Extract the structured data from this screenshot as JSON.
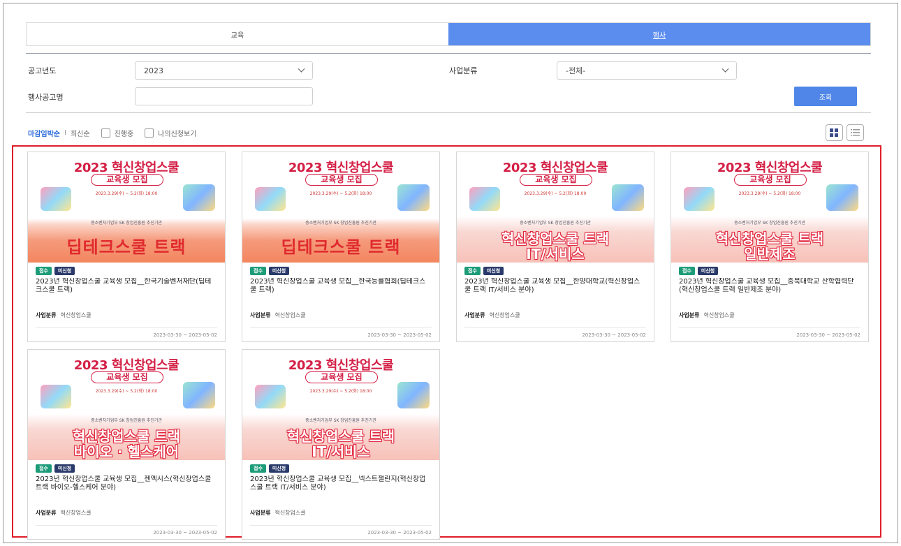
{
  "tabs": [
    {
      "label": "교육",
      "active": false
    },
    {
      "label": "행사",
      "active": true
    }
  ],
  "filters": {
    "year_label": "공고년도",
    "year_value": "2023",
    "category_label": "사업분류",
    "category_value": "-전체-",
    "name_label": "행사공고명",
    "name_value": "",
    "search_button": "조회"
  },
  "sort": {
    "deadline": "마감임박순",
    "separator": "I",
    "latest": "최신순",
    "in_progress": "진행중",
    "my_applications": "나의신청보기"
  },
  "poster": {
    "headline": "2023 혁신창업스쿨",
    "subline": "교육생 모집",
    "dates": "2023.3.29(수) ~ 5.2(화) 18:00",
    "logos": "중소벤처기업부  SK 창업진흥원  추진기관"
  },
  "colors": {
    "accent": "#5b8def",
    "search_button": "#4f86e8",
    "highlight_border": "#e01e2a",
    "status_badge": "#1e9c7a",
    "flag_badge": "#2a3a6a"
  },
  "cards": [
    {
      "track": [
        "딥테크스쿨 트랙"
      ],
      "style": "orange",
      "status": "접수",
      "flag": "미신청",
      "title": "2023년 혁신창업스쿨 교육생 모집__한국기술벤처재단(딥테크스쿨 트랙)",
      "category_label": "사업분류",
      "category": "혁신창업스쿨",
      "period": "2023-03-30 ~ 2023-05-02"
    },
    {
      "track": [
        "딥테크스쿨 트랙"
      ],
      "style": "orange",
      "status": "접수",
      "flag": "미신청",
      "title": "2023년 혁신창업스쿨 교육생 모집__한국능률협회(딥테크스쿨 트랙)",
      "category_label": "사업분류",
      "category": "혁신창업스쿨",
      "period": "2023-03-30 ~ 2023-05-02"
    },
    {
      "track": [
        "혁신창업스쿨 트랙",
        "IT/서비스"
      ],
      "style": "pink",
      "status": "접수",
      "flag": "미신청",
      "title": "2023년 혁신창업스쿨 교육생 모집__한양대학교(혁신창업스쿨 트랙 IT/서비스 분야)",
      "category_label": "사업분류",
      "category": "혁신창업스쿨",
      "period": "2023-03-30 ~ 2023-05-02"
    },
    {
      "track": [
        "혁신창업스쿨 트랙",
        "일반제조"
      ],
      "style": "pink",
      "status": "접수",
      "flag": "미신청",
      "title": "2023년 혁신창업스쿨 교육생 모집__충북대학교 산학협력단(혁신창업스쿨 트랙 일반제조 분야)",
      "category_label": "사업분류",
      "category": "혁신창업스쿨",
      "period": "2023-03-30 ~ 2023-05-02"
    },
    {
      "track": [
        "혁신창업스쿨 트랙",
        "바이오 · 헬스케어"
      ],
      "style": "pink",
      "status": "접수",
      "flag": "미신청",
      "title": "2023년 혁신창업스쿨 교육생 모집__젠엑시스(혁신창업스쿨 트랙 바이오-헬스케어 분야)",
      "category_label": "사업분류",
      "category": "혁신창업스쿨",
      "period": "2023-03-30 ~ 2023-05-02"
    },
    {
      "track": [
        "혁신창업스쿨 트랙",
        "IT/서비스"
      ],
      "style": "pink",
      "status": "접수",
      "flag": "미신청",
      "title": "2023년 혁신창업스쿨 교육생 모집__넥스트챌린지(혁신창업스쿨 트랙 IT/서비스 분야)",
      "category_label": "사업분류",
      "category": "혁신창업스쿨",
      "period": "2023-03-30 ~ 2023-05-02"
    }
  ]
}
